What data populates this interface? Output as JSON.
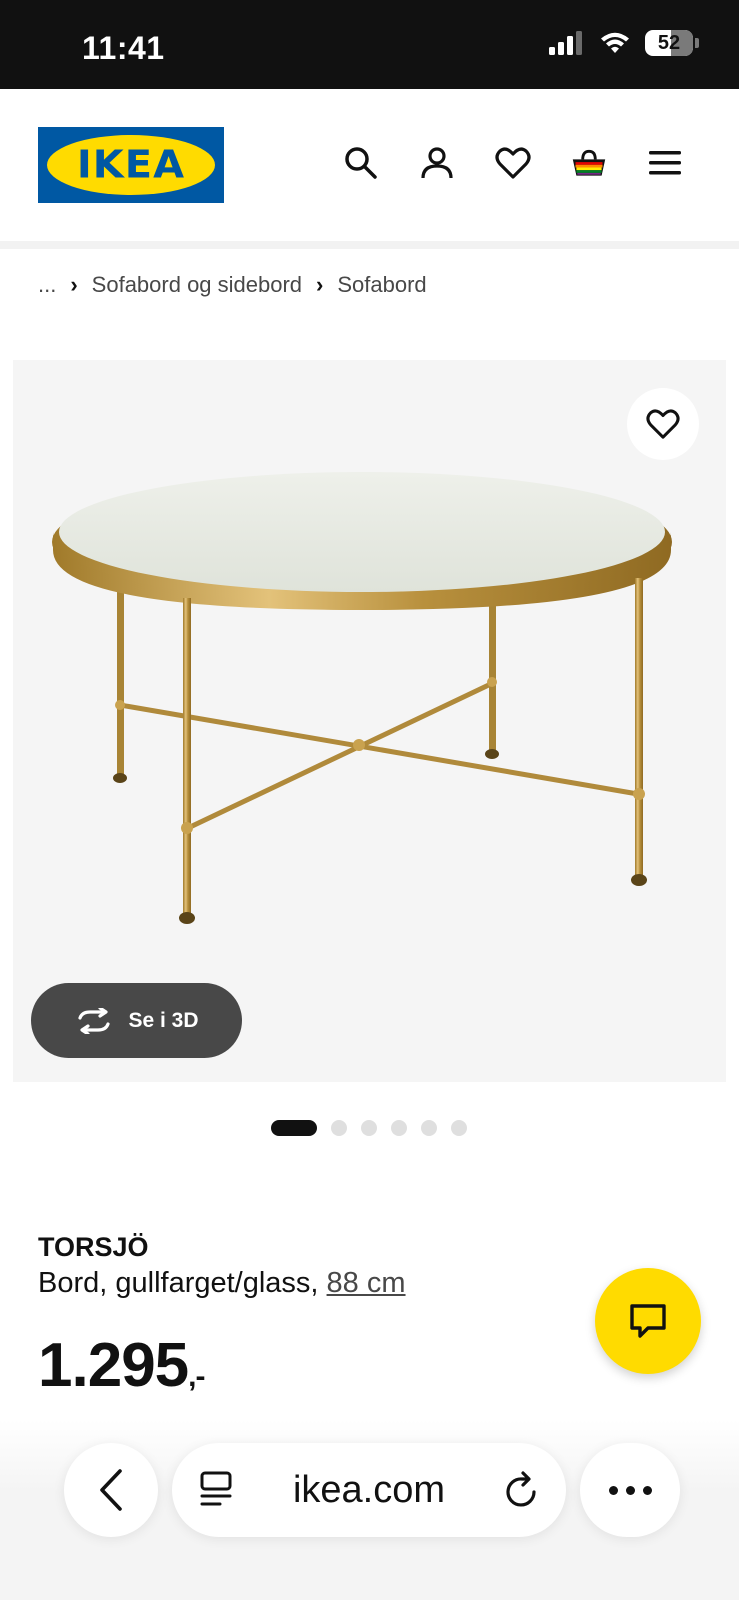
{
  "status_bar": {
    "time": "11:41",
    "battery": "52"
  },
  "header": {
    "logo_text": "IKEA",
    "icons": [
      "search-icon",
      "user-icon",
      "heart-icon",
      "basket-icon",
      "menu-icon"
    ]
  },
  "breadcrumb": {
    "items": [
      "...",
      "Sofabord og sidebord",
      "Sofabord"
    ],
    "separator": "›"
  },
  "product": {
    "view_3d_label": "Se i 3D",
    "carousel_count": 6,
    "carousel_active_index": 0,
    "name": "TORSJÖ",
    "description": "Bord, gullfarget/glass,",
    "size": "88 cm",
    "price": "1.295",
    "price_suffix": ",-"
  },
  "browser": {
    "url": "ikea.com"
  },
  "colors": {
    "ikea_blue": "#0058a3",
    "ikea_yellow": "#ffdb00",
    "status_bar": "#111111",
    "pill_dark": "#484848"
  }
}
